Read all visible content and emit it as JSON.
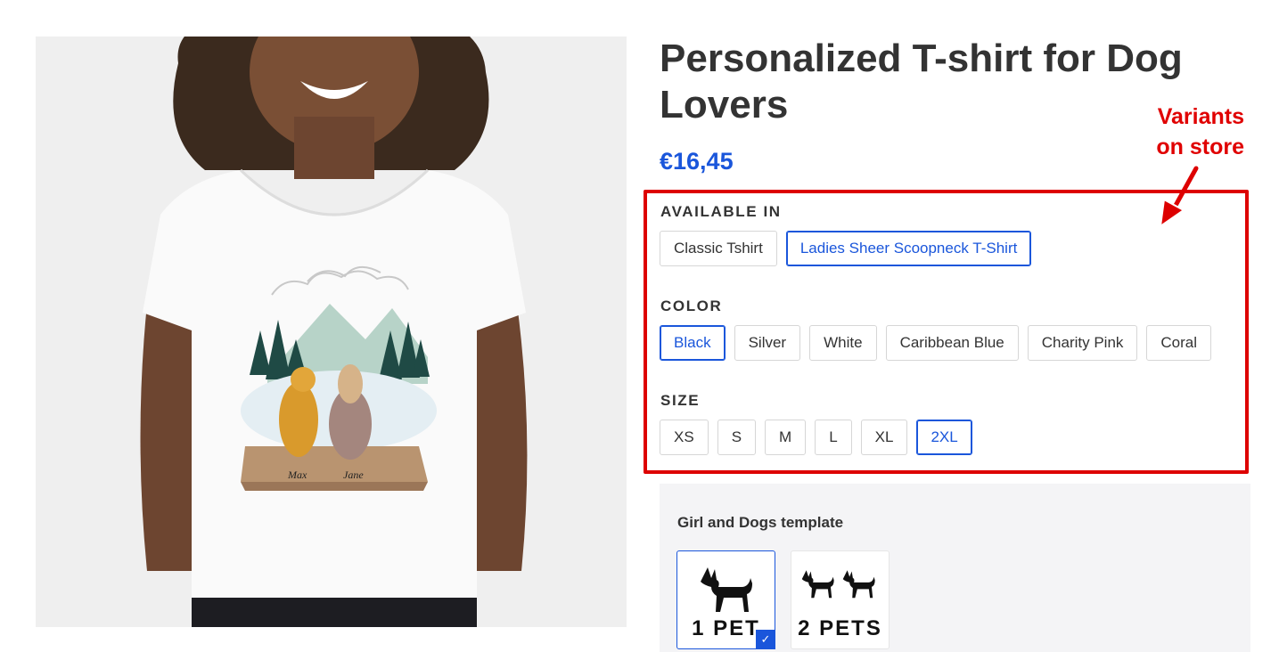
{
  "product": {
    "title": "Personalized T-shirt for Dog Lovers",
    "price": "€16,45",
    "image_names": [
      "Max",
      "Jane"
    ]
  },
  "annotation": {
    "line1": "Variants",
    "line2": "on store",
    "color": "#dd0000"
  },
  "options": {
    "available_in": {
      "label": "AVAILABLE IN",
      "values": [
        "Classic Tshirt",
        "Ladies Sheer Scoopneck T-Shirt"
      ],
      "selected": "Ladies Sheer Scoopneck T-Shirt"
    },
    "color": {
      "label": "COLOR",
      "values": [
        "Black",
        "Silver",
        "White",
        "Caribbean Blue",
        "Charity Pink",
        "Coral"
      ],
      "selected": "Black"
    },
    "size": {
      "label": "SIZE",
      "values": [
        "XS",
        "S",
        "M",
        "L",
        "XL",
        "2XL"
      ],
      "selected": "2XL"
    }
  },
  "personalization": {
    "title": "Girl and Dogs template",
    "templates": [
      {
        "label": "1 PET",
        "icon": "dog-icon",
        "selected": true
      },
      {
        "label": "2 PETS",
        "icon": "two-dogs-icon",
        "selected": false
      }
    ]
  },
  "colors": {
    "accent": "#1a56db",
    "text": "#333333",
    "panel": "#f4f4f6"
  }
}
